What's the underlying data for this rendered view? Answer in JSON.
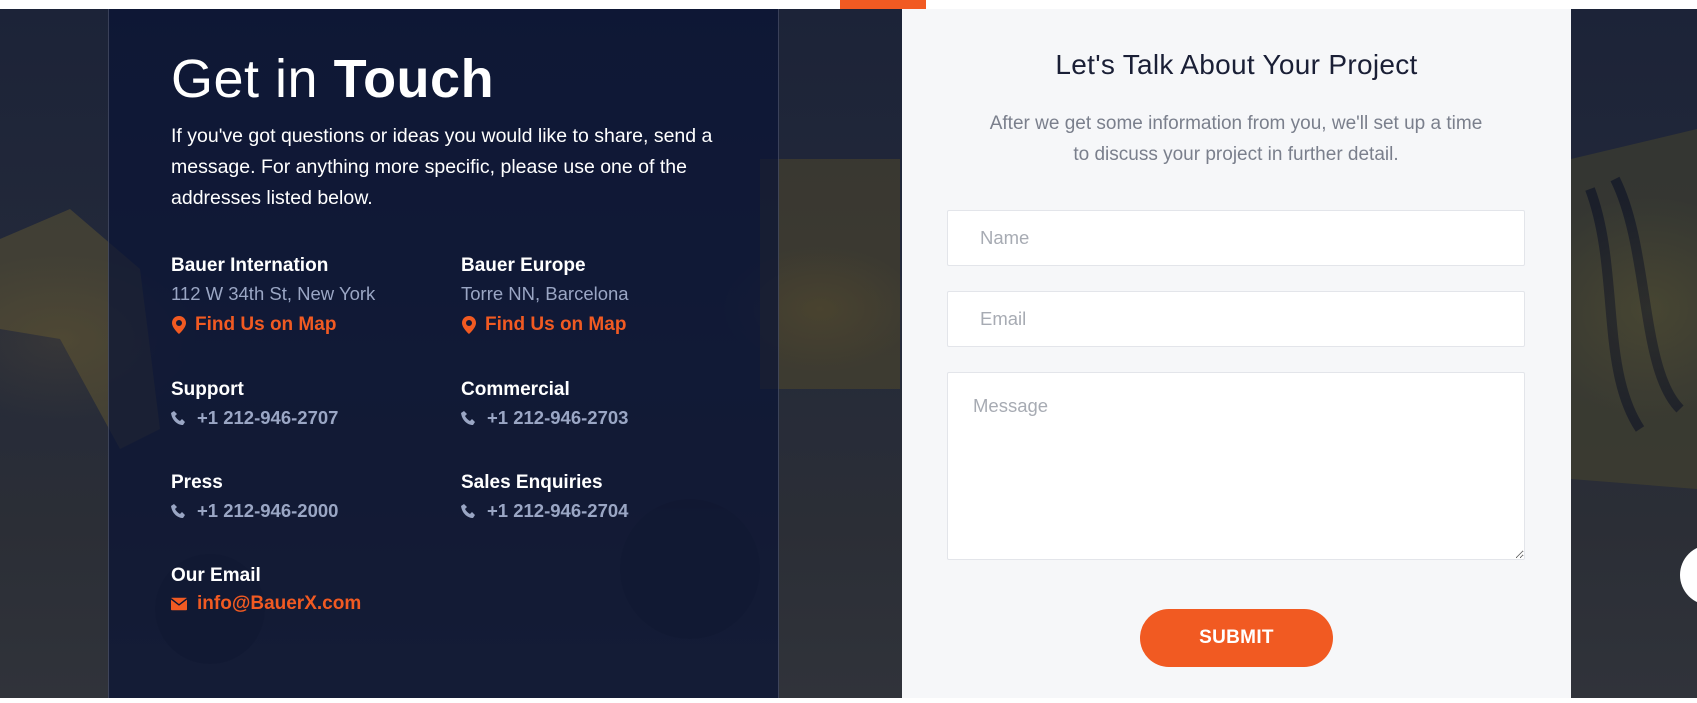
{
  "contact": {
    "heading_light": "Get in",
    "heading_bold": "Touch",
    "intro": "If you've got questions or ideas you would like to share, send a message. For anything more specific, please use one of the addresses listed below.",
    "offices": [
      {
        "name": "Bauer Internation",
        "address": "112 W 34th St, New York",
        "map_link": "Find Us on Map"
      },
      {
        "name": "Bauer Europe",
        "address": "Torre NN, Barcelona",
        "map_link": "Find Us on Map"
      }
    ],
    "phones": [
      {
        "label": "Support",
        "number": "+1 212-946-2707"
      },
      {
        "label": "Commercial",
        "number": "+1 212-946-2703"
      },
      {
        "label": "Press",
        "number": "+1 212-946-2000"
      },
      {
        "label": "Sales Enquiries",
        "number": "+1 212-946-2704"
      }
    ],
    "email_label": "Our Email",
    "email": "info@BauerX.com"
  },
  "form": {
    "title": "Let's Talk About Your Project",
    "subtitle": "After we get some information from you, we'll set up a time to discuss your project in further detail.",
    "name_placeholder": "Name",
    "email_placeholder": "Email",
    "message_placeholder": "Message",
    "submit_label": "SUBMIT"
  },
  "colors": {
    "accent": "#f15a22",
    "dark_panel": "#0a1434",
    "muted_text": "#9aa6c4"
  },
  "icons": {
    "map": "map-marker-icon",
    "phone": "phone-icon",
    "email": "envelope-icon"
  }
}
